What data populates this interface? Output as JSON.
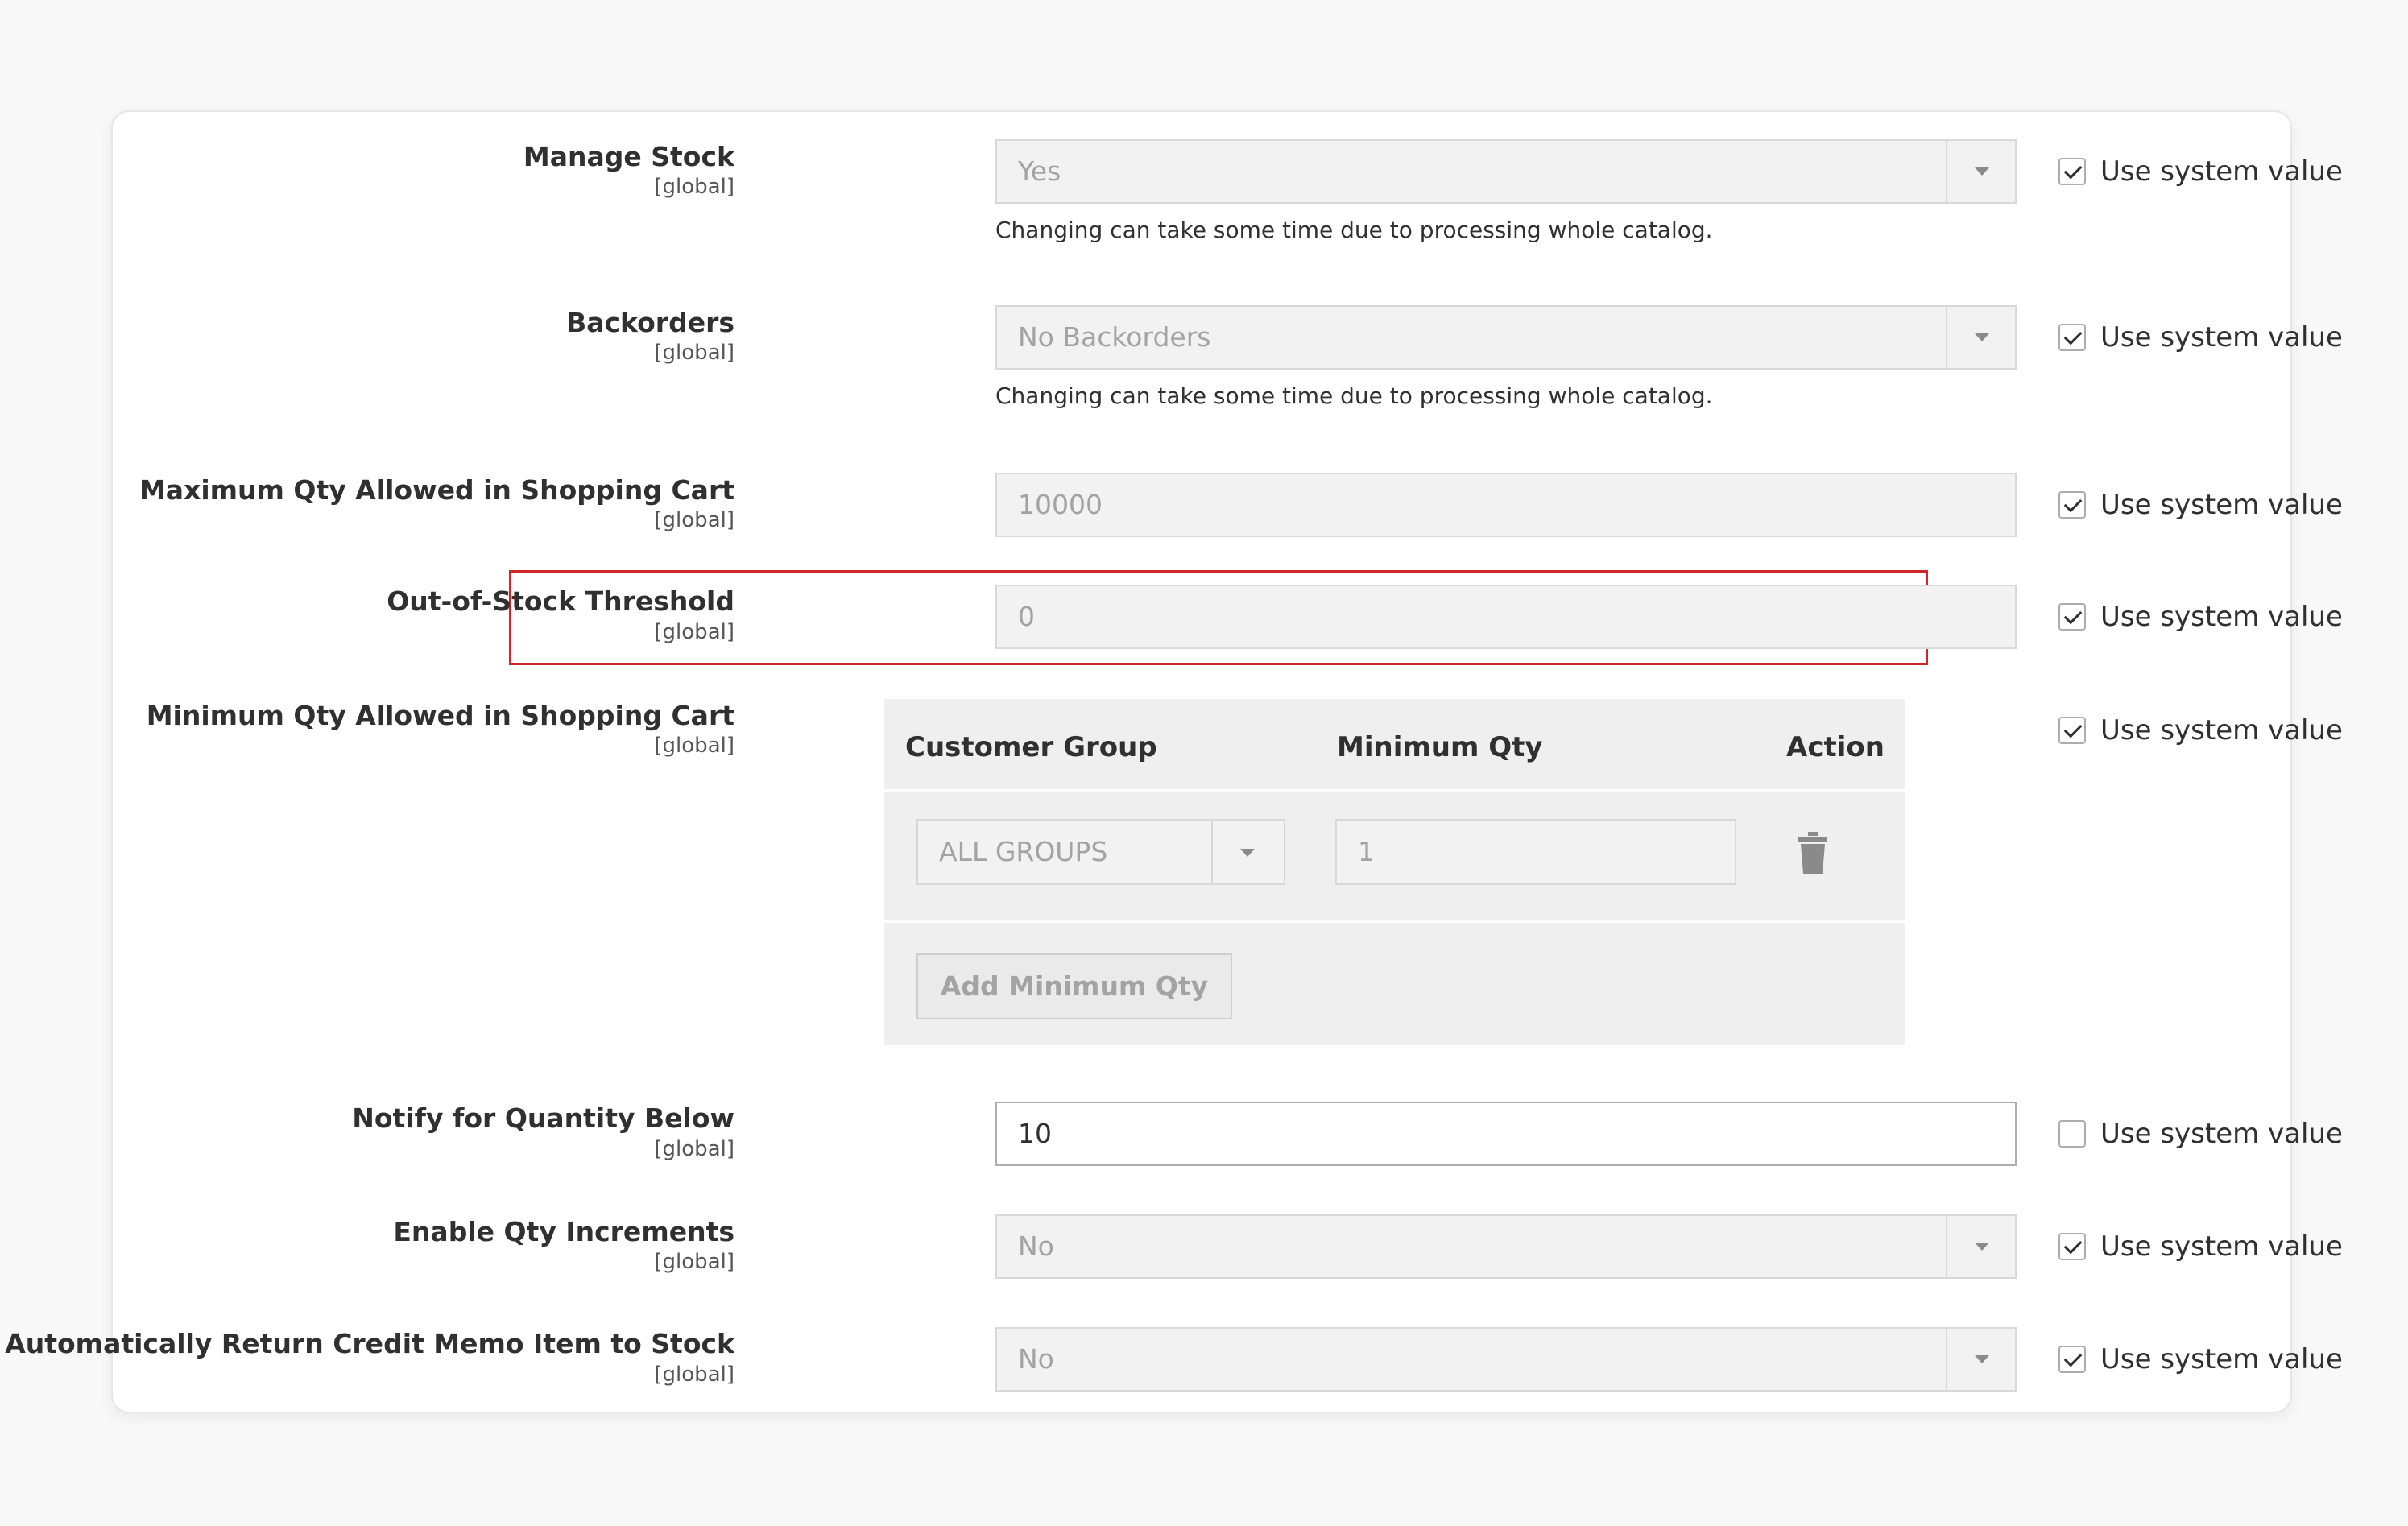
{
  "system_value_label": "Use system value",
  "fields": {
    "manage_stock": {
      "label": "Manage Stock",
      "scope": "[global]",
      "value": "Yes",
      "note": "Changing can take some time due to processing whole catalog.",
      "use_system": true
    },
    "backorders": {
      "label": "Backorders",
      "scope": "[global]",
      "value": "No Backorders",
      "note": "Changing can take some time due to processing whole catalog.",
      "use_system": true
    },
    "max_qty": {
      "label": "Maximum Qty Allowed in Shopping Cart",
      "scope": "[global]",
      "value": "10000",
      "use_system": true
    },
    "out_of_stock": {
      "label": "Out-of-Stock Threshold",
      "scope": "[global]",
      "value": "0",
      "use_system": true
    },
    "min_qty": {
      "label": "Minimum Qty Allowed in Shopping Cart",
      "scope": "[global]",
      "use_system": true,
      "headers": {
        "group": "Customer Group",
        "qty": "Minimum Qty",
        "action": "Action"
      },
      "rows": [
        {
          "group": "ALL GROUPS",
          "qty": "1"
        }
      ],
      "add_button": "Add Minimum Qty"
    },
    "notify_below": {
      "label": "Notify for Quantity Below",
      "scope": "[global]",
      "value": "10",
      "use_system": false
    },
    "qty_increments": {
      "label": "Enable Qty Increments",
      "scope": "[global]",
      "value": "No",
      "use_system": true
    },
    "auto_return": {
      "label": "Automatically Return Credit Memo Item to Stock",
      "scope": "[global]",
      "value": "No",
      "use_system": true
    }
  },
  "colors": {
    "highlight_border": "#d0252a",
    "disabled_bg": "#f2f2f2",
    "card_bg": "#ffffff",
    "page_bg": "#f8f8f8"
  }
}
